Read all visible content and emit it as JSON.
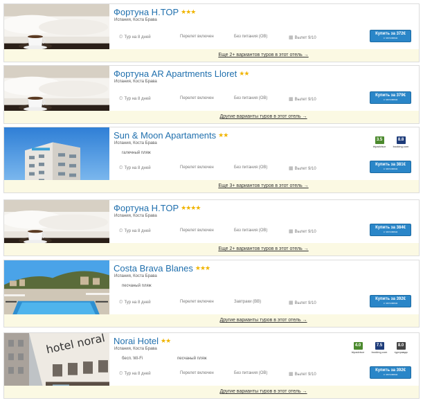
{
  "cards": [
    {
      "title": "Фортуна H.TOP",
      "stars": "★★★",
      "location": "Испания, Коста Брава",
      "features": [],
      "meta": {
        "tour": "Тур на 8 дней",
        "flight": "Перелет включен",
        "meal": "Без питания (OB)",
        "departure": "Вылет 9/10"
      },
      "buy": {
        "price": "Купить за 372€",
        "sub": "с человека"
      },
      "more": "Еще 2+ вариантов туров в этот отель →",
      "ratings": [],
      "image": "bed-cup"
    },
    {
      "title": "Фортуна AR Apartments Lloret",
      "stars": "★★",
      "location": "Испания, Коста Брава",
      "features": [],
      "meta": {
        "tour": "Тур на 8 дней",
        "flight": "Перелет включен",
        "meal": "Без питания (OB)",
        "departure": "Вылет 9/10"
      },
      "buy": {
        "price": "Купить за 379€",
        "sub": "с человека"
      },
      "more": "Другие варианты туров в этот отель →",
      "ratings": [],
      "image": "bed-cup"
    },
    {
      "title": "Sun & Moon Apartaments",
      "stars": "★★",
      "location": "Испания, Коста Брава",
      "features": [
        "галечный пляж"
      ],
      "meta": {
        "tour": "Тур на 8 дней",
        "flight": "Перелет включен",
        "meal": "Без питания (OB)",
        "departure": "Вылет 9/10"
      },
      "buy": {
        "price": "Купить за 381€",
        "sub": "с человека"
      },
      "more": "Еще 3+ вариантов туров в этот отель →",
      "ratings": [
        {
          "score": "3.5",
          "source": "tripadvisor",
          "color": "#4c8a2e"
        },
        {
          "score": "8.8",
          "source": "booking.com",
          "color": "#1e3c7a"
        }
      ],
      "image": "building"
    },
    {
      "title": "Фортуна H.TOP",
      "stars": "★★★★",
      "location": "Испания, Коста Брава",
      "features": [],
      "meta": {
        "tour": "Тур на 8 дней",
        "flight": "Перелет включен",
        "meal": "Без питания (OB)",
        "departure": "Вылет 9/10"
      },
      "buy": {
        "price": "Купить за 384€",
        "sub": "с человека"
      },
      "more": "Еще 2+ вариантов туров в этот отель →",
      "ratings": [],
      "image": "bed-cup"
    },
    {
      "title": "Costa Brava Blanes",
      "stars": "★★★",
      "location": "Испания, Коста Брава",
      "features": [
        "песчаный пляж"
      ],
      "meta": {
        "tour": "Тур на 8 дней",
        "flight": "Перелет включен",
        "meal": "Завтраки (BB)",
        "departure": "Вылет 9/10"
      },
      "buy": {
        "price": "Купить за 392€",
        "sub": "с человека"
      },
      "more": "Другие варианты туров в этот отель →",
      "ratings": [],
      "image": "pool"
    },
    {
      "title": "Norai Hotel",
      "stars": "★★",
      "location": "Испания, Коста Брава",
      "features": [
        "бесп. Wi-Fi",
        "песчаный пляж"
      ],
      "meta": {
        "tour": "Тур на 8 дней",
        "flight": "Перелет включен",
        "meal": "Без питания (OB)",
        "departure": "Вылет 9/10"
      },
      "buy": {
        "price": "Купить за 392€",
        "sub": "с человека"
      },
      "more": "Другие варианты туров в этот отель →",
      "ratings": [
        {
          "score": "4.0",
          "source": "tripadvisor",
          "color": "#4c8a2e"
        },
        {
          "score": "7.5",
          "source": "booking.com",
          "color": "#1e3c7a"
        },
        {
          "score": "8.0",
          "source": "турправда",
          "color": "#444444"
        }
      ],
      "image": "street"
    }
  ]
}
